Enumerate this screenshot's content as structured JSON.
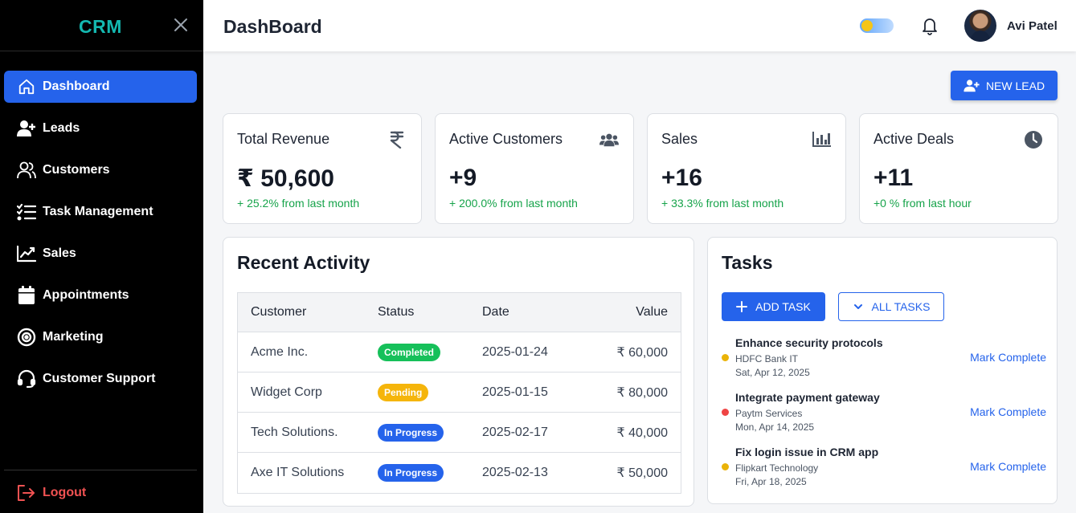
{
  "sidebar": {
    "brand": "CRM",
    "items": [
      {
        "label": "Dashboard",
        "icon": "home-icon"
      },
      {
        "label": "Leads",
        "icon": "user-plus-icon"
      },
      {
        "label": "Customers",
        "icon": "users-icon"
      },
      {
        "label": "Task Management",
        "icon": "task-list-icon"
      },
      {
        "label": "Sales",
        "icon": "chart-line-icon"
      },
      {
        "label": "Appointments",
        "icon": "calendar-icon"
      },
      {
        "label": "Marketing",
        "icon": "target-icon"
      },
      {
        "label": "Customer Support",
        "icon": "headset-icon"
      }
    ],
    "logout": "Logout"
  },
  "header": {
    "title": "DashBoard",
    "user_name": "Avi Patel"
  },
  "actions": {
    "new_lead": "NEW LEAD"
  },
  "stats": [
    {
      "title": "Total Revenue",
      "value": "₹ 50,600",
      "change": "+ 25.2% from last month",
      "icon": "rupee-icon"
    },
    {
      "title": "Active Customers",
      "value": "+9",
      "change": "+ 200.0% from last month",
      "icon": "users-icon"
    },
    {
      "title": "Sales",
      "value": "+16",
      "change": "+ 33.3% from last month",
      "icon": "bar-chart-icon"
    },
    {
      "title": "Active Deals",
      "value": "+11",
      "change": "+0 % from last hour",
      "icon": "clock-icon"
    }
  ],
  "activity": {
    "title": "Recent Activity",
    "columns": [
      "Customer",
      "Status",
      "Date",
      "Value"
    ],
    "rows": [
      {
        "customer": "Acme Inc.",
        "status": "Completed",
        "date": "2025-01-24",
        "value": "₹ 60,000"
      },
      {
        "customer": "Widget Corp",
        "status": "Pending",
        "date": "2025-01-15",
        "value": "₹ 80,000"
      },
      {
        "customer": "Tech Solutions.",
        "status": "In Progress",
        "date": "2025-02-17",
        "value": "₹ 40,000"
      },
      {
        "customer": "Axe IT Solutions",
        "status": "In Progress",
        "date": "2025-02-13",
        "value": "₹ 50,000"
      }
    ]
  },
  "tasks": {
    "title": "Tasks",
    "add_task": "ADD TASK",
    "all_tasks": "ALL TASKS",
    "mark_complete": "Mark Complete",
    "items": [
      {
        "title": "Enhance security protocols",
        "org": "HDFC Bank IT",
        "date": "Sat, Apr 12, 2025",
        "color": "#eab308"
      },
      {
        "title": "Integrate payment gateway",
        "org": "Paytm Services",
        "date": "Mon, Apr 14, 2025",
        "color": "#ef4444"
      },
      {
        "title": "Fix login issue in CRM app",
        "org": "Flipkart Technology",
        "date": "Fri, Apr 18, 2025",
        "color": "#eab308"
      }
    ]
  },
  "colors": {
    "accent": "#2563eb",
    "brand": "#14b8b0",
    "positive": "#16a34a",
    "logout": "#f05252"
  }
}
